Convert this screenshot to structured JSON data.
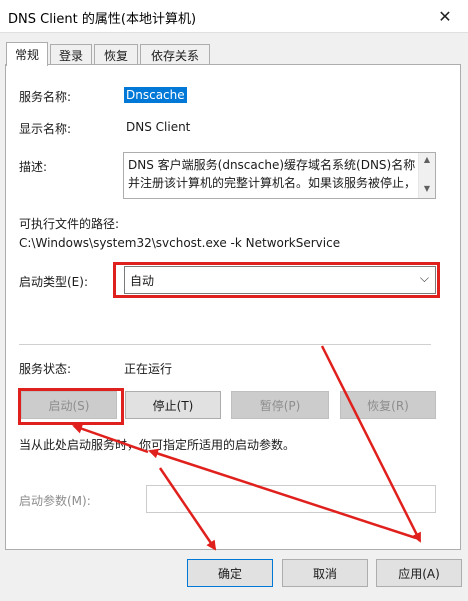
{
  "window": {
    "title": "DNS Client 的属性(本地计算机)",
    "close_glyph": "✕"
  },
  "tabs": [
    {
      "label": "常规",
      "active": true
    },
    {
      "label": "登录",
      "active": false
    },
    {
      "label": "恢复",
      "active": false
    },
    {
      "label": "依存关系",
      "active": false
    }
  ],
  "general": {
    "service_name_label": "服务名称:",
    "service_name_value": "Dnscache",
    "display_name_label": "显示名称:",
    "display_name_value": "DNS Client",
    "description_label": "描述:",
    "description_line1": "DNS 客户端服务(dnscache)缓存域名系统(DNS)名称",
    "description_line2": "并注册该计算机的完整计算机名。如果该服务被停止，",
    "exe_path_label": "可执行文件的路径:",
    "exe_path_value": "C:\\Windows\\system32\\svchost.exe -k NetworkService",
    "startup_type_label": "启动类型(E):",
    "startup_type_value": "自动",
    "service_status_label": "服务状态:",
    "service_status_value": "正在运行",
    "buttons": {
      "start": "启动(S)",
      "stop": "停止(T)",
      "pause": "暂停(P)",
      "resume": "恢复(R)"
    },
    "hint": "当从此处启动服务时，你可指定所适用的启动参数。",
    "start_params_label": "启动参数(M):",
    "start_params_value": ""
  },
  "footer": {
    "ok": "确定",
    "cancel": "取消",
    "apply": "应用(A)"
  },
  "annotation_color": "#e0201c"
}
